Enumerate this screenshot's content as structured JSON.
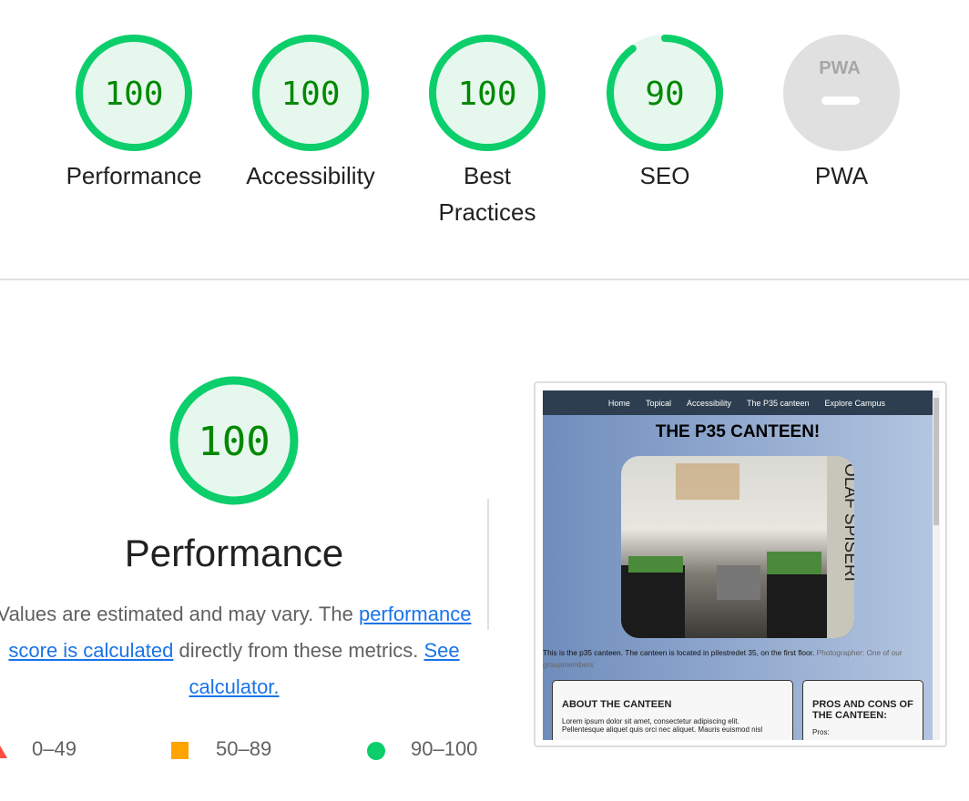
{
  "colors": {
    "pass": "#0cce6b",
    "pass_fill": "#e6f8ee",
    "pass_text": "#008800",
    "average": "#ffa400",
    "fail": "#ff4e42",
    "na": "#e0e0e0"
  },
  "categories": [
    {
      "label": "Performance",
      "score": "100",
      "value": 100
    },
    {
      "label": "Accessibility",
      "score": "100",
      "value": 100
    },
    {
      "label": "Best Practices",
      "score": "100",
      "value": 100
    },
    {
      "label": "SEO",
      "score": "90",
      "value": 90
    },
    {
      "label": "PWA",
      "score": "",
      "logo_text": "PWA",
      "icon": "pwa-dash-icon"
    }
  ],
  "performance": {
    "score": "100",
    "title": "Performance",
    "desc_prefix": "Values are estimated and may vary. The ",
    "link1": "performance score is calculated",
    "desc_mid": " directly from these metrics. ",
    "link2": "See calculator."
  },
  "legend": [
    {
      "range": "0–49",
      "icon": "triangle-icon"
    },
    {
      "range": "50–89",
      "icon": "square-icon"
    },
    {
      "range": "90–100",
      "icon": "circle-icon"
    }
  ],
  "screenshot": {
    "nav": [
      "Home",
      "Topical",
      "Accessibility",
      "The P35 canteen",
      "Explore Campus"
    ],
    "title": "THE P35 CANTEEN!",
    "sign": "OLAF SPISERI",
    "caption": "This is the p35 canteen. The canteen is located in pilestredet 35, on the first floor. ",
    "credit": "Photographer: One of our groupmembers",
    "card1_title": "ABOUT THE CANTEEN",
    "card1_text": "Lorem ipsum dolor sit amet, consectetur adipiscing elit. Pellentesque aliquet quis orci nec aliquet. Mauris euismod nisl",
    "card2_title": "PROS AND CONS OF THE CANTEEN:",
    "card2_text": "Pros:"
  }
}
